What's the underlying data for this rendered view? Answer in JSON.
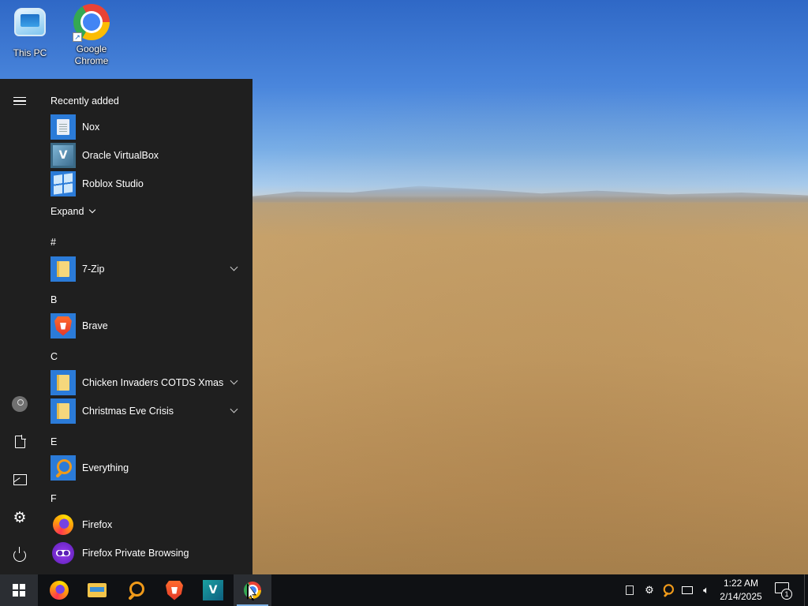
{
  "desktop": {
    "icons": [
      {
        "label": "This PC",
        "icon": "this-pc-icon"
      },
      {
        "label": "Google\nChrome",
        "icon": "chrome-icon"
      }
    ]
  },
  "start_menu": {
    "recently_added_title": "Recently added",
    "recently_added": [
      {
        "label": "Nox",
        "icon": "nox-icon"
      },
      {
        "label": "Oracle VirtualBox",
        "icon": "virtualbox-icon"
      },
      {
        "label": "Roblox Studio",
        "icon": "roblox-studio-icon"
      }
    ],
    "expand_label": "Expand",
    "groups": [
      {
        "letter": "#",
        "apps": [
          {
            "label": "7-Zip",
            "icon": "folder-icon",
            "expandable": true
          }
        ]
      },
      {
        "letter": "B",
        "apps": [
          {
            "label": "Brave",
            "icon": "brave-icon",
            "expandable": false
          }
        ]
      },
      {
        "letter": "C",
        "apps": [
          {
            "label": "Chicken Invaders COTDS Xmas",
            "icon": "folder-icon",
            "expandable": true
          },
          {
            "label": "Christmas Eve Crisis",
            "icon": "folder-icon",
            "expandable": true
          }
        ]
      },
      {
        "letter": "E",
        "apps": [
          {
            "label": "Everything",
            "icon": "everything-icon",
            "expandable": false
          }
        ]
      },
      {
        "letter": "F",
        "apps": [
          {
            "label": "Firefox",
            "icon": "firefox-icon",
            "expandable": false
          },
          {
            "label": "Firefox Private Browsing",
            "icon": "firefox-private-icon",
            "expandable": false
          }
        ]
      }
    ],
    "rail": [
      "hamburger-menu-icon",
      "user-account-icon",
      "documents-icon",
      "pictures-icon",
      "settings-gear-icon",
      "power-icon"
    ]
  },
  "taskbar": {
    "pinned": [
      "windows-start-icon",
      "firefox-icon",
      "file-explorer-icon",
      "everything-icon",
      "brave-icon",
      "virtualbox-icon",
      "chrome-icon"
    ],
    "tray": {
      "time": "1:22 AM",
      "date": "2/14/2025",
      "notification_count": "1"
    }
  },
  "colors": {
    "start_menu_bg": "#1f1f1f",
    "taskbar_bg": "#0f1114",
    "tile_blue": "#2b7bd8"
  }
}
